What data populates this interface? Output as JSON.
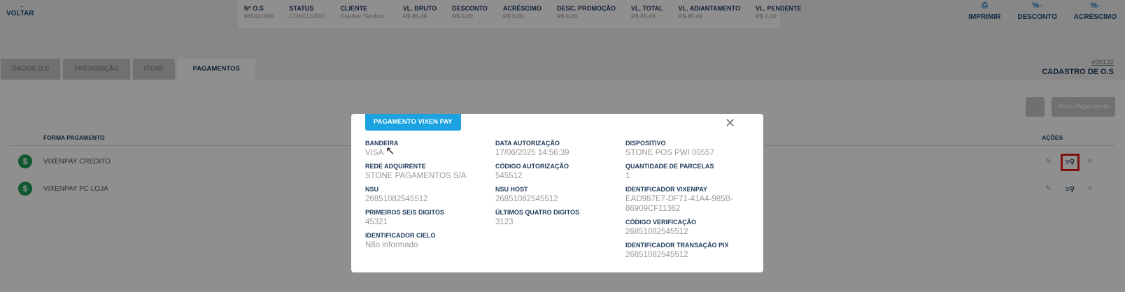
{
  "header": {
    "back_label": "VOLTAR",
    "summary": [
      {
        "label": "Nº O.S",
        "value": "965321965"
      },
      {
        "label": "STATUS",
        "value": "CONCLUÍDO"
      },
      {
        "label": "CLIENTE",
        "value": "Glauber Teodoro"
      },
      {
        "label": "VL. BRUTO",
        "value": "R$ 85,49"
      },
      {
        "label": "DESCONTO",
        "value": "R$ 0,00"
      },
      {
        "label": "ACRÉSCIMO",
        "value": "R$ 0,00"
      },
      {
        "label": "DESC. PROMOÇÃO",
        "value": "R$ 0,00"
      },
      {
        "label": "VL. TOTAL",
        "value": "R$ 85,49"
      },
      {
        "label": "VL. ADIANTAMENTO",
        "value": "R$ 85,49"
      },
      {
        "label": "VL. PENDENTE",
        "value": "R$ 0,00"
      }
    ],
    "actions": {
      "print": "IMPRIMIR",
      "discount": "DESCONTO",
      "surcharge": "ACRÉSCIMO"
    }
  },
  "tabs": [
    "DADOS O.S",
    "PRESCRIÇÃO",
    "ITENS",
    "PAGAMENTOS"
  ],
  "order": {
    "number": "#36132",
    "title": "CADASTRO DE O.S"
  },
  "payments": {
    "new_button": "Novo Pagamento",
    "columns": {
      "method": "FORMA PAGAMENTO",
      "actions": "AÇÕES"
    },
    "rows": [
      {
        "icon": "$",
        "name": "VIXENPAY CREDITO"
      },
      {
        "icon": "$",
        "name": "VIXENPAY PC LOJA"
      }
    ]
  },
  "modal": {
    "title": "PAGAMENTO VIXEN PAY",
    "fields": {
      "bandeira": {
        "label": "BANDEIRA",
        "value": "VISA"
      },
      "rede": {
        "label": "REDE ADQUIRENTE",
        "value": "STONE PAGAMENTOS S/A"
      },
      "nsu": {
        "label": "NSU",
        "value": "26851082545512"
      },
      "primeiros": {
        "label": "PRIMEIROS SEIS DIGITOS",
        "value": "45321"
      },
      "cielo": {
        "label": "IDENTIFICADOR CIELO",
        "value": "Não informado"
      },
      "data": {
        "label": "DATA AUTORIZAÇÃO",
        "value": "17/06/2025 14:56:39"
      },
      "codigo": {
        "label": "CÓDIGO AUTORIZAÇÃO",
        "value": "545512"
      },
      "nsu_host": {
        "label": "NSU HOST",
        "value": "26851082545512"
      },
      "ultimos": {
        "label": "ÚLTIMOS QUATRO DIGITOS",
        "value": "3123"
      },
      "dispositivo": {
        "label": "DISPOSITIVO",
        "value": "STONE POS PWI 00557"
      },
      "parcelas": {
        "label": "QUANTIDADE DE PARCELAS",
        "value": "1"
      },
      "vixenpay_id": {
        "label": "IDENTIFICADOR VIXENPAY",
        "value_line1": "EAD987E7-DF71-41A4-985B-",
        "value_line2": "86909CF11362"
      },
      "verificacao": {
        "label": "CÓDIGO VERIFICAÇÃO",
        "value": "26851082545512"
      },
      "pix": {
        "label": "IDENTIFICADOR TRANSAÇÃO PIX",
        "value": "26851082545512"
      }
    }
  }
}
